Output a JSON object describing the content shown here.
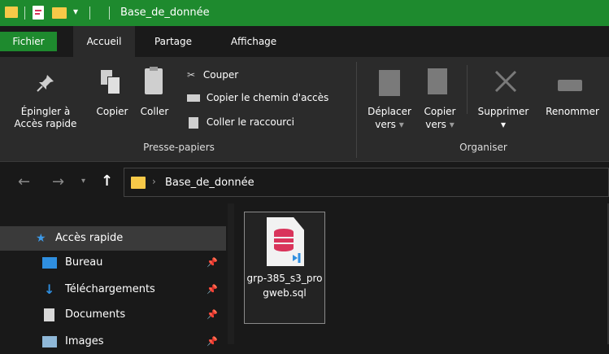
{
  "window": {
    "title": "Base_de_donnée"
  },
  "tabs": [
    {
      "label": "Fichier"
    },
    {
      "label": "Accueil"
    },
    {
      "label": "Partage"
    },
    {
      "label": "Affichage"
    }
  ],
  "ribbon": {
    "pin": {
      "line1": "Épingler à",
      "line2": "Accès rapide"
    },
    "copy": "Copier",
    "paste": "Coller",
    "cut": "Couper",
    "copy_path": "Copier le chemin d'accès",
    "paste_shortcut": "Coller le raccourci",
    "clipboard_group": "Presse-papiers",
    "move": {
      "line1": "Déplacer",
      "line2": "vers"
    },
    "copyto": {
      "line1": "Copier",
      "line2": "vers"
    },
    "delete": "Supprimer",
    "rename": "Renommer",
    "organize_group": "Organiser"
  },
  "address": {
    "path": "Base_de_donnée"
  },
  "sidebar": {
    "items": [
      {
        "label": "Accès rapide"
      },
      {
        "label": "Bureau"
      },
      {
        "label": "Téléchargements"
      },
      {
        "label": "Documents"
      },
      {
        "label": "Images"
      }
    ]
  },
  "files": [
    {
      "name": "grp-385_s3_progweb.sql"
    }
  ],
  "colors": {
    "accent": "#1e8a2e",
    "folder": "#f7c948",
    "sql_icon": "#d9345b",
    "selection": "#3a3a3a"
  }
}
